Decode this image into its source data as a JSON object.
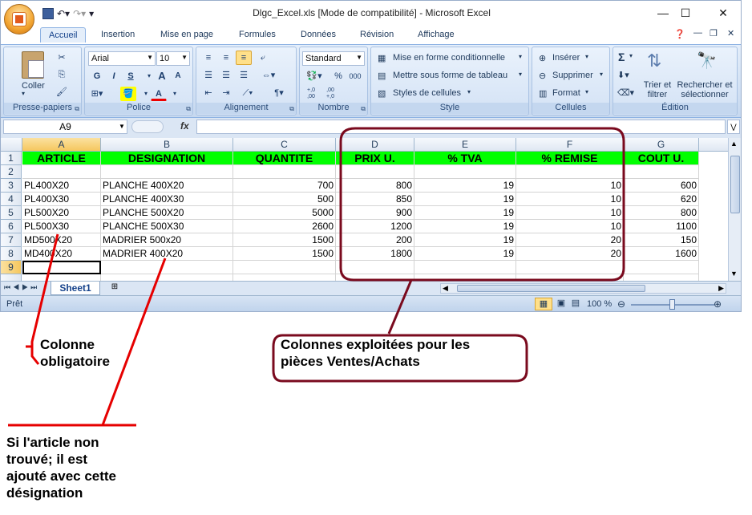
{
  "window": {
    "title": "Dlgc_Excel.xls  [Mode de compatibilité] - Microsoft Excel"
  },
  "tabs": [
    "Accueil",
    "Insertion",
    "Mise en page",
    "Formules",
    "Données",
    "Révision",
    "Affichage"
  ],
  "ribbon": {
    "clipboard": {
      "paste": "Coller",
      "label": "Presse-papiers"
    },
    "font": {
      "name": "Arial",
      "size": "10",
      "bold": "G",
      "italic": "I",
      "underline": "S",
      "grow": "A",
      "shrink": "A",
      "label": "Police"
    },
    "alignment": {
      "label": "Alignement"
    },
    "number": {
      "format": "Standard",
      "percent": "%",
      "thousands": "000",
      "inc": "+,0\n,00",
      "dec": ",00\n+,0",
      "label": "Nombre"
    },
    "style": {
      "conditional": "Mise en forme conditionnelle",
      "table": "Mettre sous forme de tableau",
      "cell_styles": "Styles de cellules",
      "label": "Style"
    },
    "cells": {
      "insert": "Insérer",
      "delete": "Supprimer",
      "format": "Format",
      "label": "Cellules"
    },
    "editing": {
      "sum": "Σ",
      "sort": "Trier et filtrer",
      "find": "Rechercher et sélectionner",
      "label": "Édition"
    }
  },
  "formula_bar": {
    "name_box": "A9",
    "fx": "fx",
    "value": ""
  },
  "columns": [
    "A",
    "B",
    "C",
    "D",
    "E",
    "F",
    "G"
  ],
  "rows": [
    "1",
    "2",
    "3",
    "4",
    "5",
    "6",
    "7",
    "8",
    "9"
  ],
  "header_row": [
    "ARTICLE",
    "DESIGNATION",
    "QUANTITE",
    "PRIX U.",
    "% TVA",
    "% REMISE",
    "COUT U."
  ],
  "data_rows": [
    [
      "PL400X20",
      "PLANCHE 400X20",
      "700",
      "800",
      "19",
      "10",
      "600"
    ],
    [
      "PL400X30",
      "PLANCHE 400X30",
      "500",
      "850",
      "19",
      "10",
      "620"
    ],
    [
      "PL500X20",
      "PLANCHE 500X20",
      "5000",
      "900",
      "19",
      "10",
      "800"
    ],
    [
      "PL500X30",
      "PLANCHE 500X30",
      "2600",
      "1200",
      "19",
      "10",
      "1100"
    ],
    [
      "MD500X20",
      "MADRIER 500x20",
      "1500",
      "200",
      "19",
      "20",
      "150"
    ],
    [
      "MD400X20",
      "MADRIER 400X20",
      "1500",
      "1800",
      "19",
      "20",
      "1600"
    ]
  ],
  "sheet": {
    "tab": "Sheet1"
  },
  "status": {
    "text": "Prêt",
    "zoom": "100 %"
  },
  "annotations": {
    "col_required": "Colonne\nobligatoire",
    "sales_cols": "Colonnes exploitées pour les\npièces Ventes/Achats",
    "not_found": "Si l'article non\ntrouvé; il est\najouté avec cette\ndésignation"
  },
  "colors": {
    "header_fill": "#00ff00",
    "annotation_red": "#e60000",
    "annotation_maroon": "#7a0a1e"
  }
}
